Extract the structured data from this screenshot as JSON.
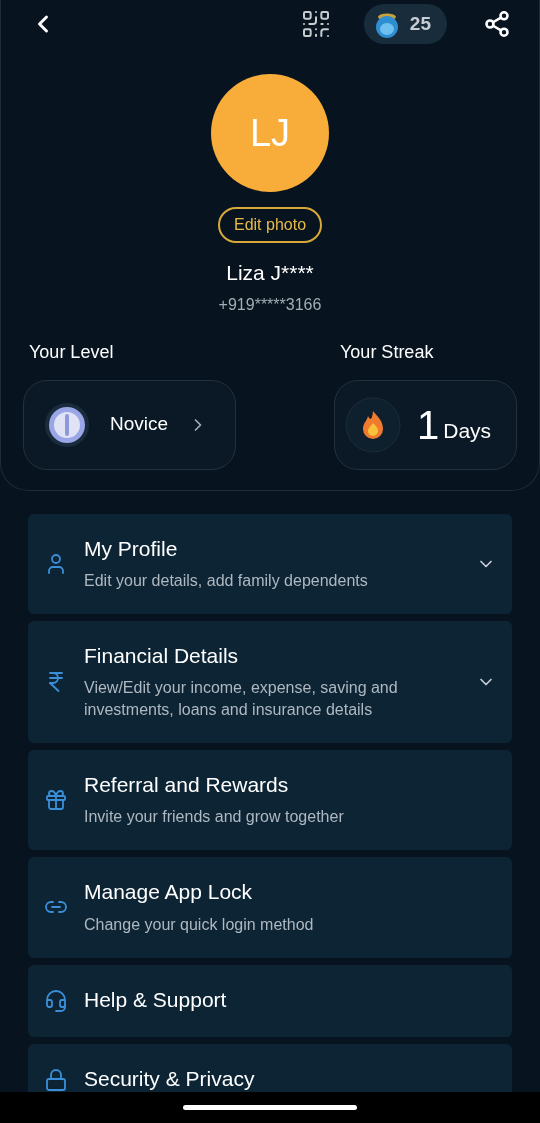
{
  "top_bar": {
    "coins": "25"
  },
  "profile": {
    "initials": "LJ",
    "edit_photo": "Edit photo",
    "name": "Liza J****",
    "phone": "+919*****3166"
  },
  "level": {
    "label": "Your Level",
    "value": "Novice"
  },
  "streak": {
    "label": "Your Streak",
    "count": "1",
    "unit": "Days"
  },
  "menu": [
    {
      "kind": "accordion",
      "title": "My Profile",
      "subtitle": "Edit your details, add family dependents",
      "expanded": false
    },
    {
      "kind": "accordion",
      "title": "Financial Details",
      "subtitle": "View/Edit your income, expense, saving and investments, loans and insurance details",
      "expanded": false
    },
    {
      "kind": "link",
      "title": "Referral and Rewards",
      "subtitle": "Invite your friends and grow together"
    },
    {
      "kind": "link",
      "title": "Manage App Lock",
      "subtitle": "Change your quick login method"
    },
    {
      "kind": "link",
      "title": "Help & Support"
    },
    {
      "kind": "link",
      "title": "Security & Privacy"
    }
  ]
}
